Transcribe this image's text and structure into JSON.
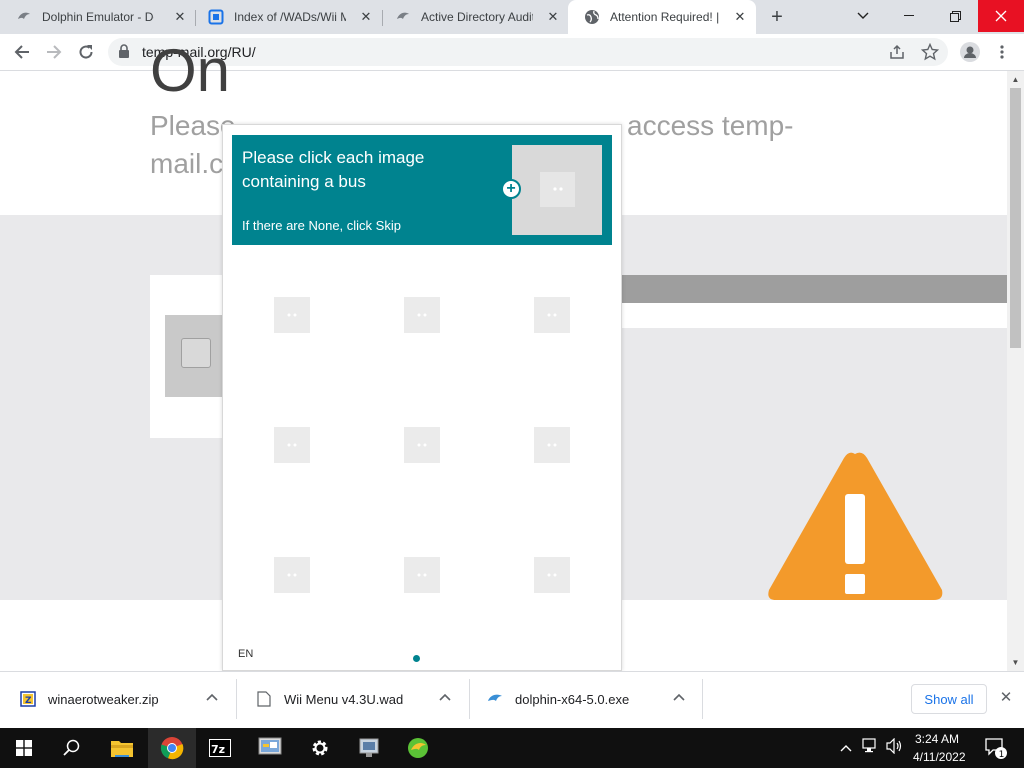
{
  "browser": {
    "tabs": [
      {
        "title": "Dolphin Emulator - Do",
        "icon": "dolphin-icon"
      },
      {
        "title": "Index of /WADs/Wii Me",
        "icon": "document-icon"
      },
      {
        "title": "Active Directory Auditi",
        "icon": "dolphin-icon"
      },
      {
        "title": "Attention Required! | C",
        "icon": "globe-icon"
      }
    ],
    "active_tab": 3,
    "url": "temp-mail.org/RU/"
  },
  "page": {
    "title_fragment": "On",
    "subtitle_line1_start": "Please",
    "subtitle_line1_end": "access temp-",
    "subtitle_line2": "mail.c"
  },
  "captcha": {
    "prompt_line1": "Please click each image",
    "prompt_line2": "containing a bus",
    "hint": "If there are None, click Skip",
    "language": "EN",
    "accent_color": "#00838f"
  },
  "downloads": [
    {
      "name": "winaerotweaker.zip",
      "icon": "zip-icon"
    },
    {
      "name": "Wii Menu v4.3U.wad",
      "icon": "file-icon"
    },
    {
      "name": "dolphin-x64-5.0.exe",
      "icon": "dolphin-icon"
    }
  ],
  "downloads_show_all": "Show all",
  "taskbar": {
    "time": "3:24 AM",
    "date": "4/11/2022",
    "notification_count": "1"
  }
}
